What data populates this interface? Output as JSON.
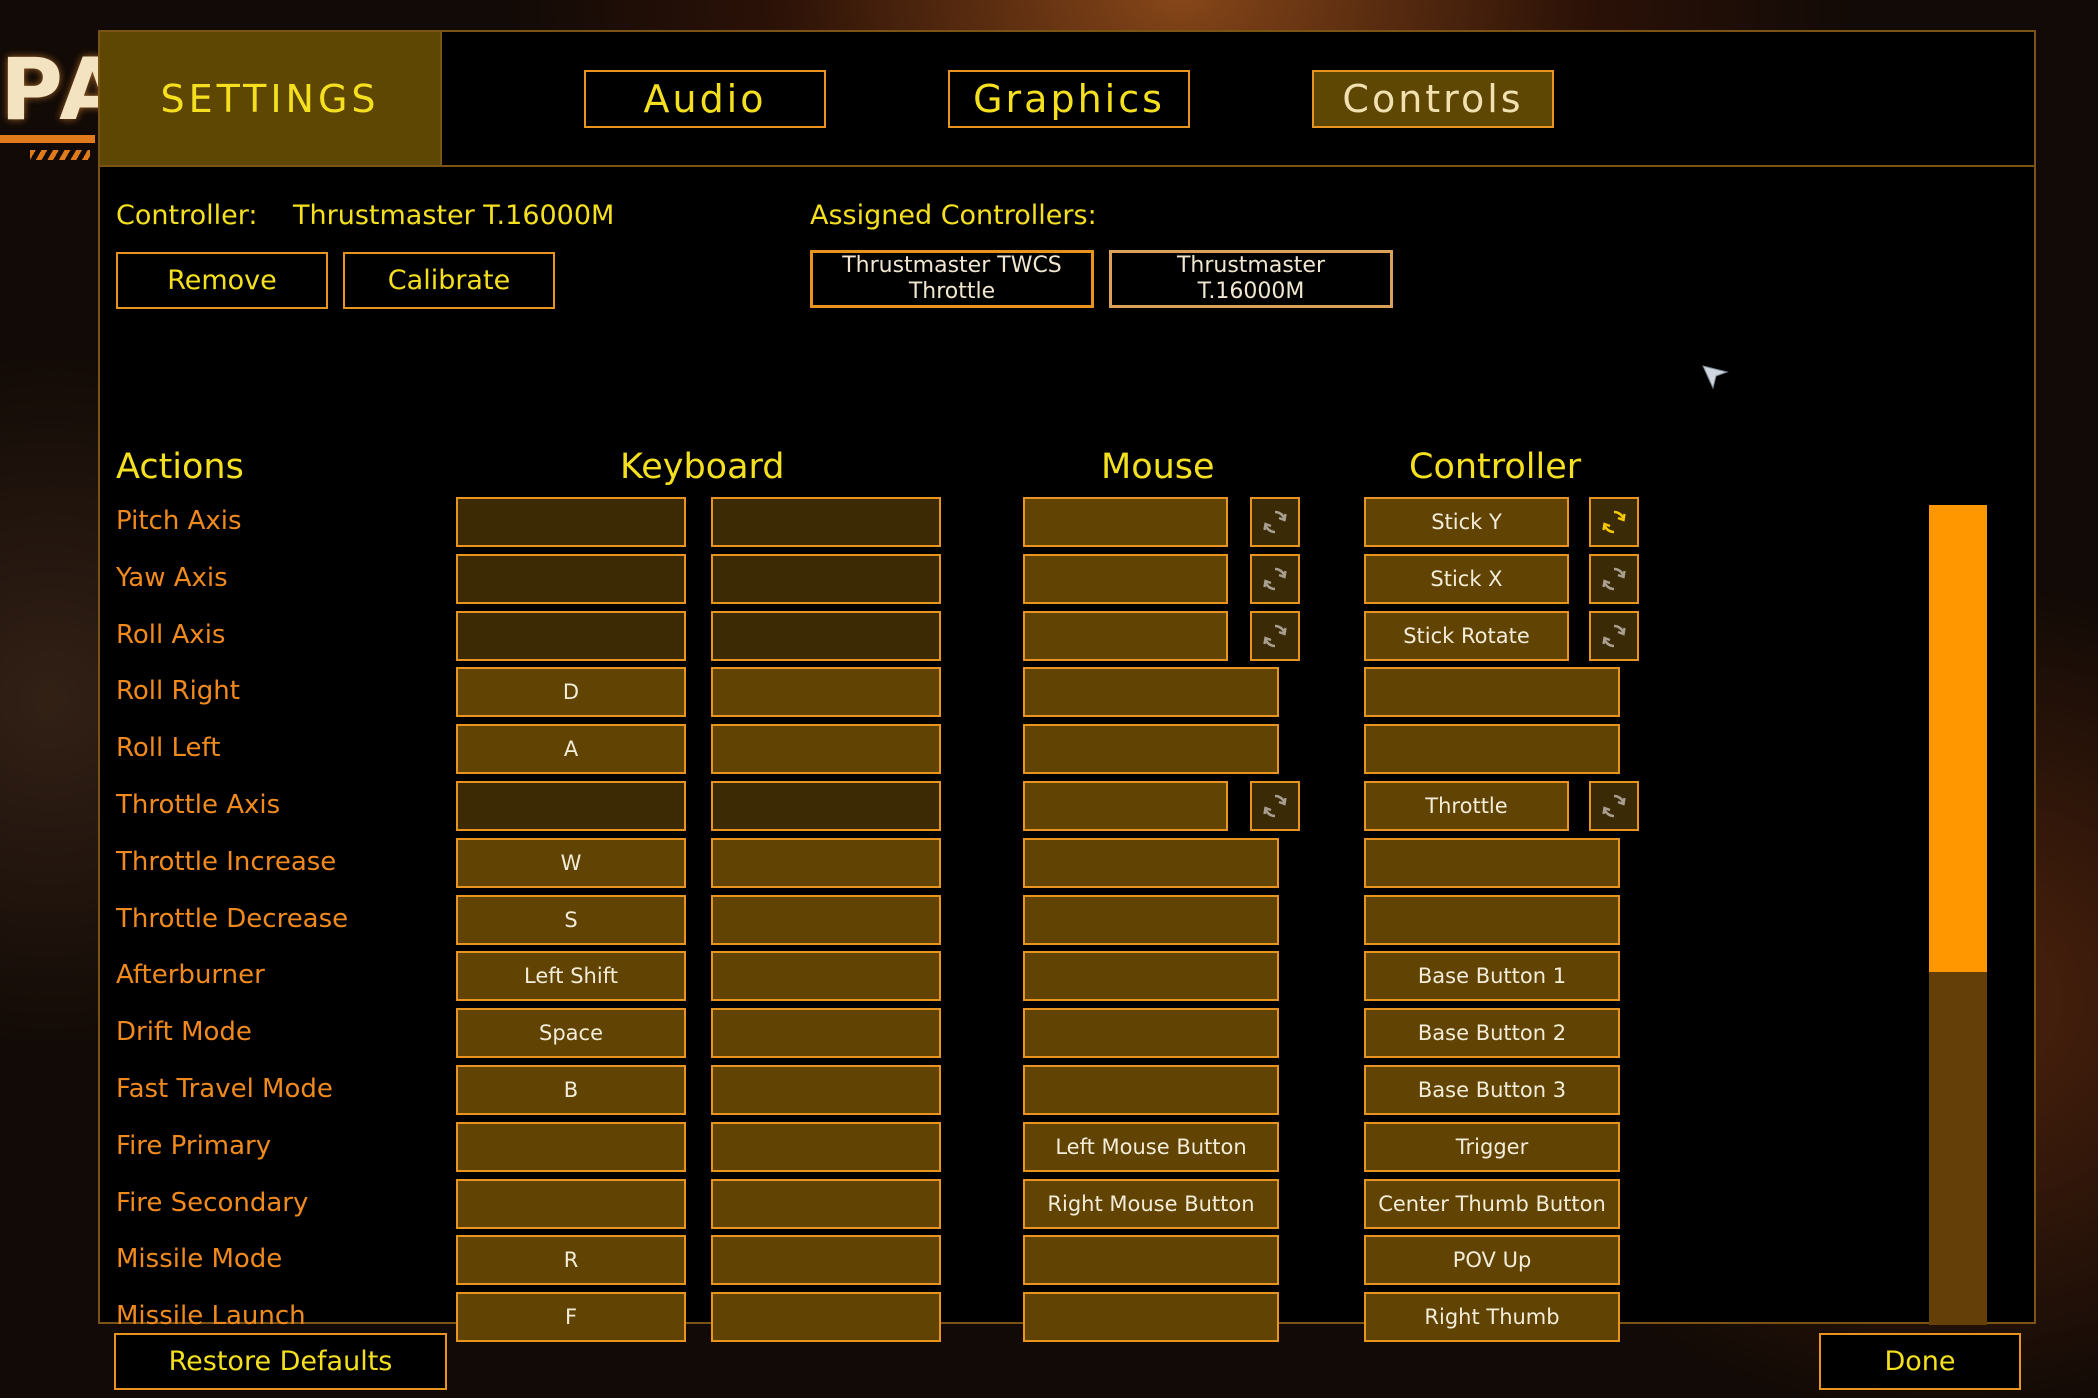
{
  "game": {
    "logo_fragment": "PA"
  },
  "header": {
    "title": "SETTINGS",
    "tabs": [
      {
        "label": "Audio"
      },
      {
        "label": "Graphics"
      },
      {
        "label": "Controls"
      }
    ],
    "active_tab": "Controls"
  },
  "controller_section": {
    "controller_label": "Controller:",
    "controller_name": "Thrustmaster T.16000M",
    "remove_label": "Remove",
    "calibrate_label": "Calibrate",
    "assigned_label": "Assigned Controllers:",
    "assigned": [
      {
        "name_line1": "Thrustmaster TWCS",
        "name_line2": "Throttle"
      },
      {
        "name_line1": "Thrustmaster",
        "name_line2": "T.16000M"
      }
    ]
  },
  "columns": {
    "actions": "Actions",
    "keyboard": "Keyboard",
    "mouse": "Mouse",
    "controller": "Controller"
  },
  "bindings": [
    {
      "action": "Pitch Axis",
      "axis": true,
      "kb1": "",
      "kb2": "",
      "mouse": "",
      "controller": "Stick Y",
      "controller_inverted": true
    },
    {
      "action": "Yaw Axis",
      "axis": true,
      "kb1": "",
      "kb2": "",
      "mouse": "",
      "controller": "Stick X",
      "controller_inverted": false
    },
    {
      "action": "Roll Axis",
      "axis": true,
      "kb1": "",
      "kb2": "",
      "mouse": "",
      "controller": "Stick Rotate",
      "controller_inverted": false
    },
    {
      "action": "Roll Right",
      "axis": false,
      "kb1": "D",
      "kb2": "",
      "mouse": "",
      "controller": ""
    },
    {
      "action": "Roll Left",
      "axis": false,
      "kb1": "A",
      "kb2": "",
      "mouse": "",
      "controller": ""
    },
    {
      "action": "Throttle Axis",
      "axis": true,
      "kb1": "",
      "kb2": "",
      "mouse": "",
      "controller": "Throttle",
      "controller_inverted": false
    },
    {
      "action": "Throttle Increase",
      "axis": false,
      "kb1": "W",
      "kb2": "",
      "mouse": "",
      "controller": ""
    },
    {
      "action": "Throttle Decrease",
      "axis": false,
      "kb1": "S",
      "kb2": "",
      "mouse": "",
      "controller": ""
    },
    {
      "action": "Afterburner",
      "axis": false,
      "kb1": "Left Shift",
      "kb2": "",
      "mouse": "",
      "controller": "Base Button 1"
    },
    {
      "action": "Drift Mode",
      "axis": false,
      "kb1": "Space",
      "kb2": "",
      "mouse": "",
      "controller": "Base Button 2"
    },
    {
      "action": "Fast Travel Mode",
      "axis": false,
      "kb1": "B",
      "kb2": "",
      "mouse": "",
      "controller": "Base Button 3"
    },
    {
      "action": "Fire Primary",
      "axis": false,
      "kb1": "",
      "kb2": "",
      "mouse": "Left Mouse Button",
      "controller": "Trigger"
    },
    {
      "action": "Fire Secondary",
      "axis": false,
      "kb1": "",
      "kb2": "",
      "mouse": "Right Mouse Button",
      "controller": "Center Thumb Button"
    },
    {
      "action": "Missile Mode",
      "axis": false,
      "kb1": "R",
      "kb2": "",
      "mouse": "",
      "controller": "POV Up"
    },
    {
      "action": "Missile Launch",
      "axis": false,
      "kb1": "F",
      "kb2": "",
      "mouse": "",
      "controller": "Right Thumb"
    }
  ],
  "scrollbar": {
    "visible_fraction": 0.57,
    "position": 0
  },
  "footer": {
    "restore_label": "Restore Defaults",
    "done_label": "Done"
  },
  "colors": {
    "accent": "#e8941f",
    "title_text": "#f5e020",
    "action_text": "#f08a1e",
    "cell_fill": "#614404",
    "axis_cell_fill": "#3b2a04",
    "scroll_thumb": "#ff9800"
  },
  "icons": {
    "invert": "refresh-icon",
    "cursor": "cursor-arrow-icon"
  }
}
